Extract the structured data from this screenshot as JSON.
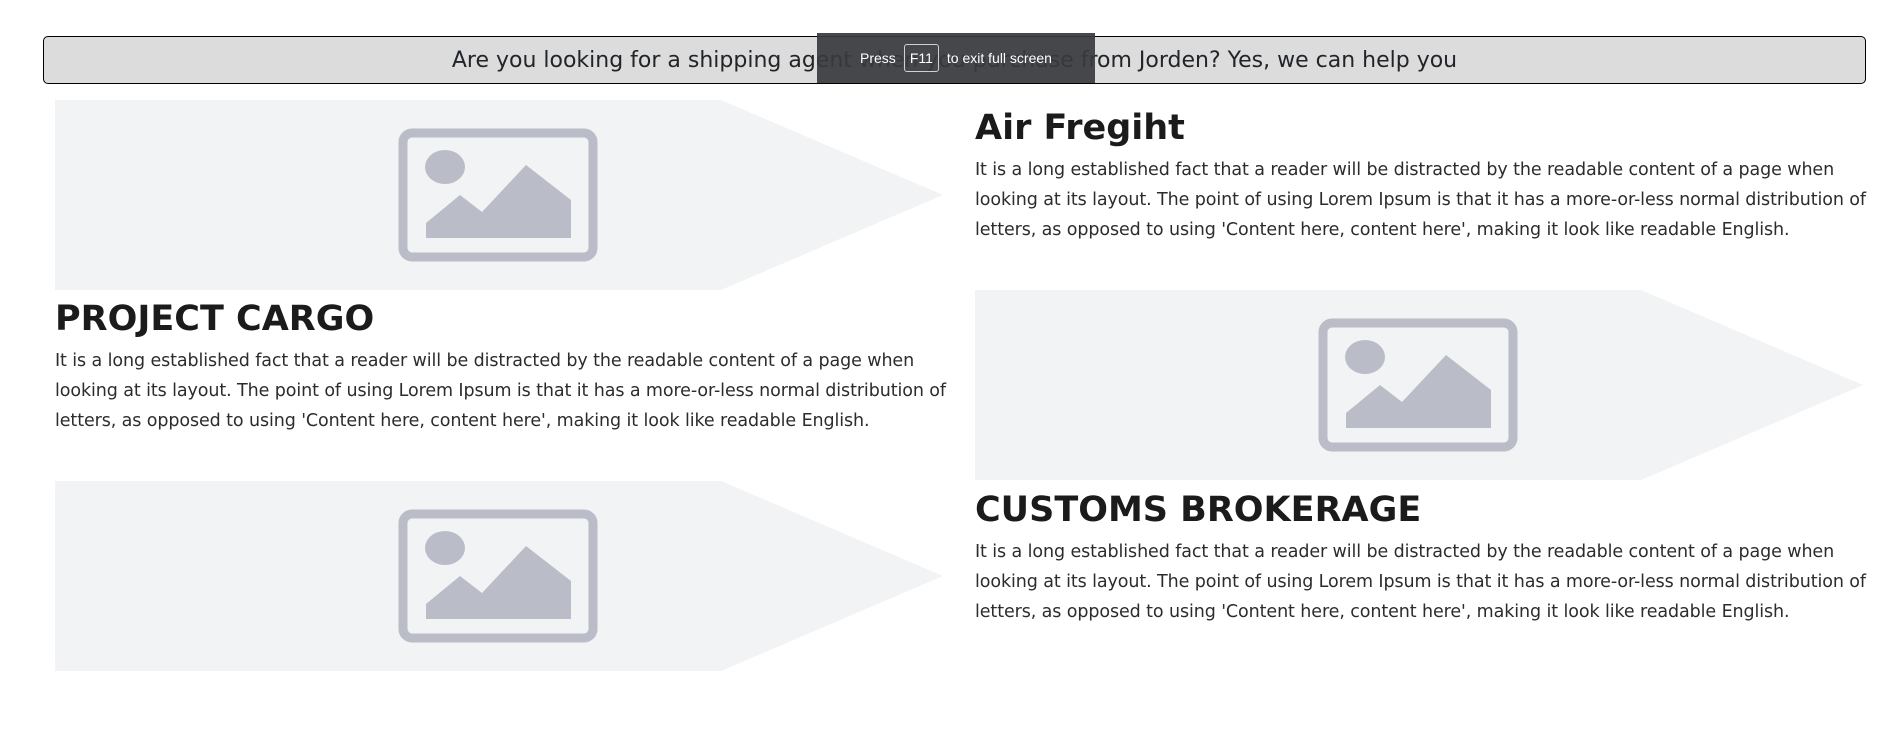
{
  "banner": {
    "text": "Are you looking for a shipping agent when you purchase from Jorden? Yes, we can help you"
  },
  "fullscreen_notice": {
    "prefix": "Press",
    "key": "F11",
    "suffix": "to exit full screen"
  },
  "sections": [
    {
      "title": "Air Fregiht",
      "body": "It is a long established fact that a reader will be distracted by the readable content of a page when looking at its layout. The point of using Lorem Ipsum is that it has a more-or-less normal distribution of letters, as opposed to using 'Content here, content here', making it look like readable English."
    },
    {
      "title": "PROJECT CARGO",
      "body": "It is a long established fact that a reader will be distracted by the readable content of a page when looking at its layout. The point of using Lorem Ipsum is that it has a more-or-less normal distribution of letters, as opposed to using 'Content here, content here', making it look like readable English."
    },
    {
      "title": "CUSTOMS BROKERAGE",
      "body": "It is a long established fact that a reader will be distracted by the readable content of a page when looking at its layout. The point of using Lorem Ipsum is that it has a more-or-less normal distribution of letters, as opposed to using 'Content here, content here', making it look like readable English."
    }
  ],
  "placeholder_images": [
    {
      "icon": "image-placeholder-icon"
    },
    {
      "icon": "image-placeholder-icon"
    },
    {
      "icon": "image-placeholder-icon"
    }
  ],
  "colors": {
    "banner_bg": "#dcdcdc",
    "placeholder_bg": "#f2f3f4",
    "placeholder_icon": "#babdc7",
    "toast_bg": "#373a3e"
  }
}
